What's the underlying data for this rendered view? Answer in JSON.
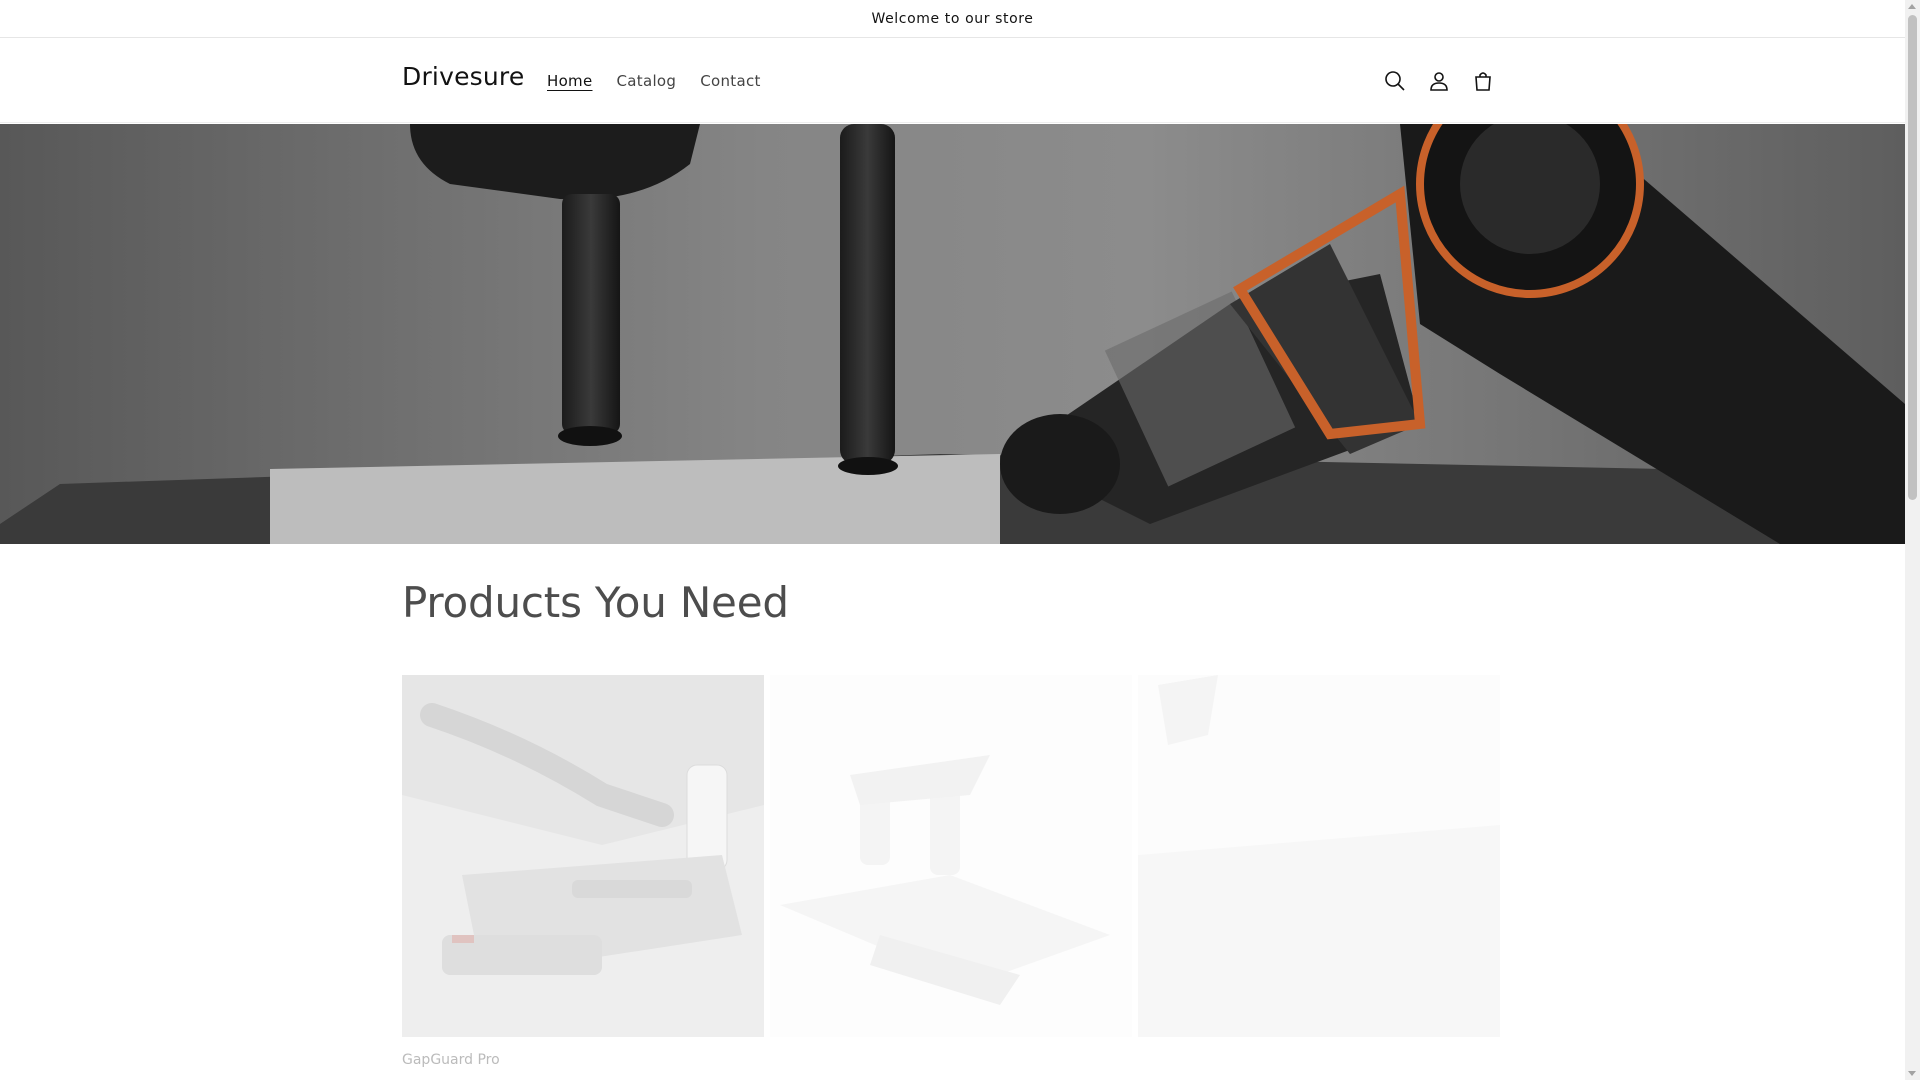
{
  "announcement": {
    "text": "Welcome to our store"
  },
  "header": {
    "logo": "Drivesure",
    "nav": [
      {
        "label": "Home",
        "active": true
      },
      {
        "label": "Catalog",
        "active": false
      },
      {
        "label": "Contact",
        "active": false
      }
    ],
    "icons": [
      "search-icon",
      "account-icon",
      "cart-icon"
    ]
  },
  "hero": {
    "image": "black handheld car vacuum with orange ring on stand"
  },
  "products": {
    "heading": "Products You Need",
    "items": [
      {
        "title": "GapGuard Pro"
      },
      {
        "title": ""
      },
      {
        "title": ""
      }
    ]
  },
  "colors": {
    "accent_orange": "#c8612a",
    "text": "#121212",
    "heading": "#4d4d4d"
  }
}
